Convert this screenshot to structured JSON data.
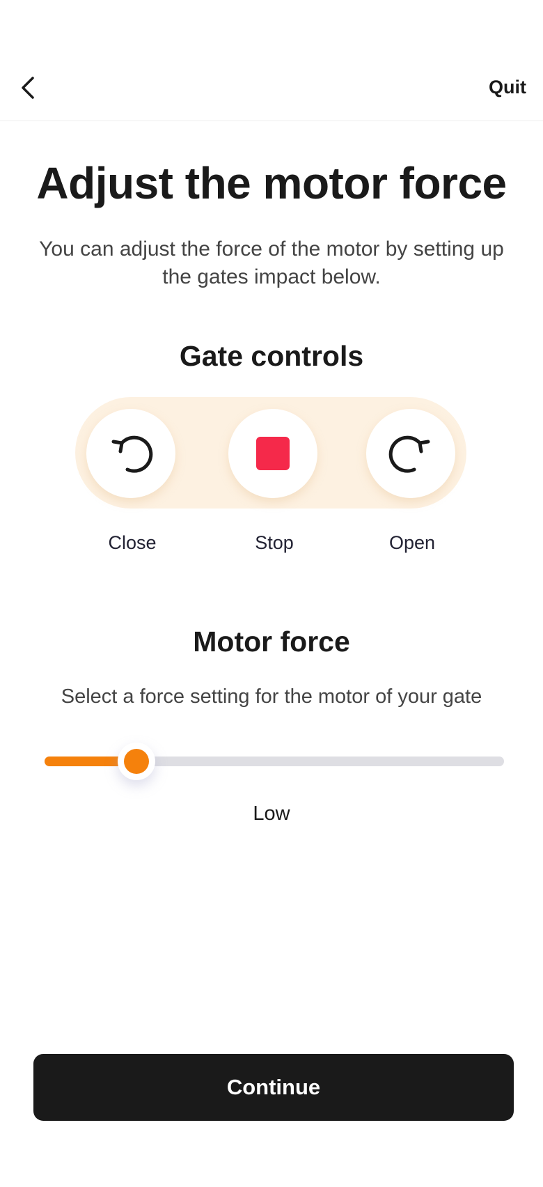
{
  "header": {
    "back_icon": "chevron-left-icon",
    "quit_label": "Quit"
  },
  "title": "Adjust the motor force",
  "subtitle": "You can adjust the force of the motor by setting up the gates impact below.",
  "gate_controls": {
    "title": "Gate controls",
    "buttons": [
      {
        "label": "Close",
        "icon": "rotate-ccw-icon"
      },
      {
        "label": "Stop",
        "icon": "stop-icon",
        "color": "#f5294a"
      },
      {
        "label": "Open",
        "icon": "rotate-cw-icon"
      }
    ]
  },
  "motor_force": {
    "title": "Motor force",
    "subtitle": "Select a force setting for the motor of your gate",
    "slider_value": 0.2,
    "value_label": "Low",
    "accent_color": "#f5810c",
    "track_color": "#dedee3"
  },
  "continue_label": "Continue"
}
